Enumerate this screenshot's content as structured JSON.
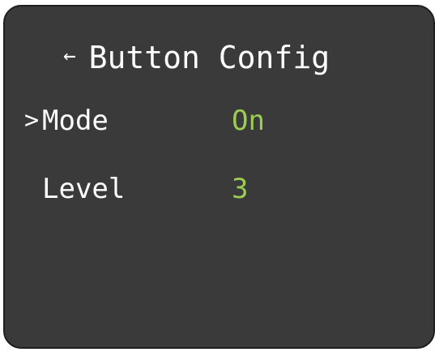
{
  "header": {
    "back_icon": "left-arrow-icon",
    "back_glyph": "←",
    "title": "Button Config"
  },
  "menu": {
    "cursor_glyph": ">",
    "items": [
      {
        "label": "Mode",
        "value": "On",
        "selected": true
      },
      {
        "label": "Level",
        "value": "3",
        "selected": false
      }
    ]
  },
  "colors": {
    "background": "#3a3a3a",
    "text": "#ffffff",
    "value": "#9acd52",
    "border": "#1e1e1e"
  }
}
